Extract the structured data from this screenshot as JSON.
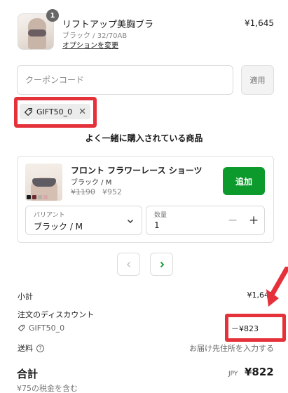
{
  "item": {
    "quantity": "1",
    "title": "リフトアップ美胸ブラ",
    "variant": "ブラック / 32/70AB",
    "option_link": "オプションを変更",
    "price": "¥1,645"
  },
  "coupon": {
    "placeholder": "クーポンコード",
    "apply_label": "適用",
    "applied_code": "GIFT50_0"
  },
  "recommended": {
    "section_title": "よく一緒に購入されている商品",
    "title": "フロント フラワーレース ショーツ",
    "variant": "ブラック / M",
    "price_original": "¥1190",
    "price_sale": "¥952",
    "add_label": "追加",
    "variant_field_label": "バリアント",
    "variant_value": "ブラック / M",
    "qty_field_label": "数量",
    "qty_value": "1",
    "swatch_colors": [
      "#1a1a1a",
      "#6d2b34",
      "#b8b1a8",
      "#d9a7ad"
    ]
  },
  "summary": {
    "subtotal_label": "小計",
    "subtotal_value": "¥1,645",
    "discount_label": "注文のディスカウント",
    "discount_code": "GIFT50_0",
    "discount_value": "－¥823",
    "shipping_label": "送料",
    "shipping_value": "お届け先住所を入力する",
    "total_label": "合計",
    "currency": "JPY",
    "total_value": "¥822",
    "tax_note": "¥75の税金を含む"
  },
  "colors": {
    "accent_green": "#0c9a2c",
    "highlight_red": "#e5313a"
  }
}
